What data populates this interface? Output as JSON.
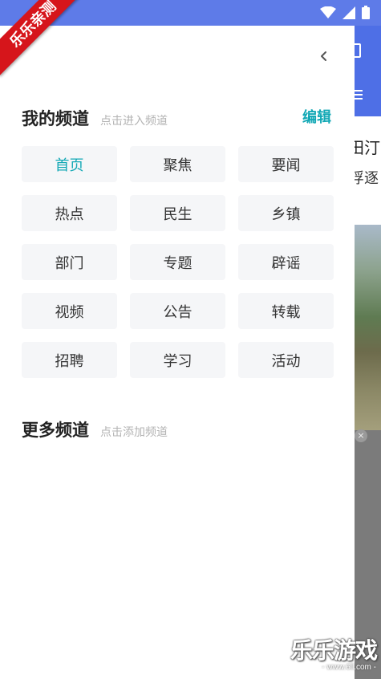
{
  "watermark": {
    "ribbon_text": "乐乐亲测",
    "logo_text": "乐乐游戏",
    "logo_url": "- www.6ll.com -"
  },
  "background_app": {
    "text_line1": "田汀",
    "text_line2": "浮逐"
  },
  "drawer": {
    "my_channels": {
      "title": "我的频道",
      "hint": "点击进入频道",
      "edit_label": "编辑",
      "items": [
        {
          "label": "首页",
          "active": true
        },
        {
          "label": "聚焦",
          "active": false
        },
        {
          "label": "要闻",
          "active": false
        },
        {
          "label": "热点",
          "active": false
        },
        {
          "label": "民生",
          "active": false
        },
        {
          "label": "乡镇",
          "active": false
        },
        {
          "label": "部门",
          "active": false
        },
        {
          "label": "专题",
          "active": false
        },
        {
          "label": "辟谣",
          "active": false
        },
        {
          "label": "视频",
          "active": false
        },
        {
          "label": "公告",
          "active": false
        },
        {
          "label": "转载",
          "active": false
        },
        {
          "label": "招聘",
          "active": false
        },
        {
          "label": "学习",
          "active": false
        },
        {
          "label": "活动",
          "active": false
        }
      ]
    },
    "more_channels": {
      "title": "更多频道",
      "hint": "点击添加频道"
    }
  },
  "icons": {
    "back": "chevron-left-icon",
    "wifi": "wifi-icon",
    "signal": "signal-icon",
    "battery": "battery-icon"
  },
  "colors": {
    "status_bar": "#5e7be8",
    "accent": "#12a8b5",
    "chip_bg": "#f5f6f8",
    "ribbon": "#d6151b"
  }
}
